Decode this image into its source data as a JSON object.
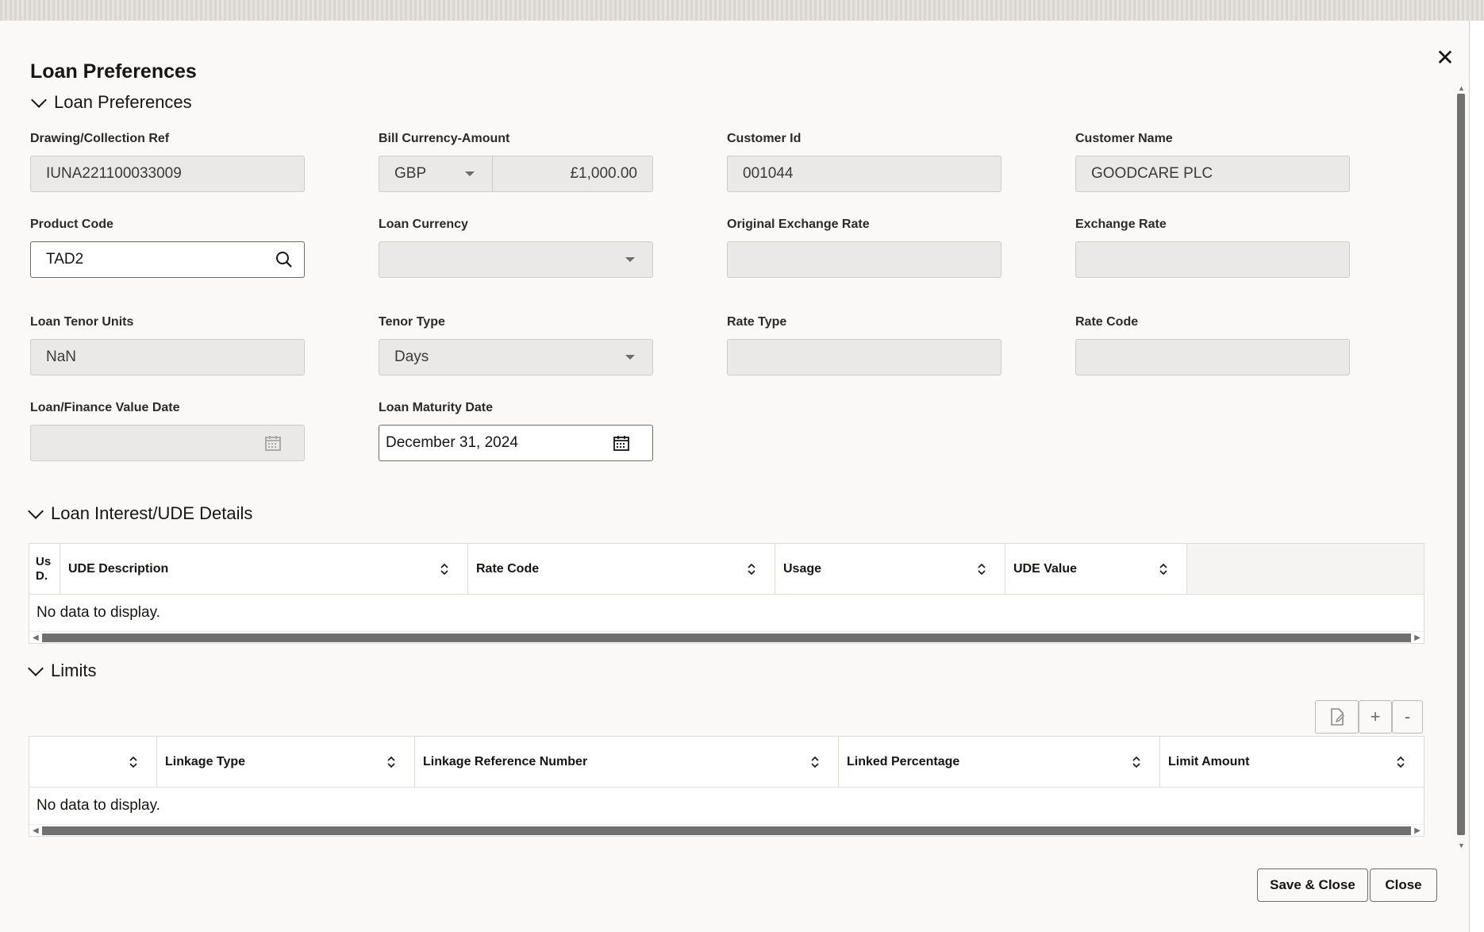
{
  "dialog": {
    "title": "Loan Preferences"
  },
  "sections": {
    "loan_preferences": "Loan Preferences",
    "interest": "Loan Interest/UDE Details",
    "limits": "Limits"
  },
  "fields": {
    "drawing_ref": {
      "label": "Drawing/Collection Ref",
      "value": "IUNA221100033009"
    },
    "bill_currency": {
      "label": "Bill Currency-Amount",
      "currency": "GBP",
      "amount": "£1,000.00"
    },
    "customer_id": {
      "label": "Customer Id",
      "value": "001044"
    },
    "customer_name": {
      "label": "Customer Name",
      "value": "GOODCARE PLC"
    },
    "product_code": {
      "label": "Product Code",
      "value": "TAD2"
    },
    "loan_currency": {
      "label": "Loan Currency",
      "value": ""
    },
    "original_exchange_rate": {
      "label": "Original Exchange Rate",
      "value": ""
    },
    "exchange_rate": {
      "label": "Exchange Rate",
      "value": ""
    },
    "loan_tenor_units": {
      "label": "Loan Tenor Units",
      "value": "NaN"
    },
    "tenor_type": {
      "label": "Tenor Type",
      "value": "Days"
    },
    "rate_type": {
      "label": "Rate Type",
      "value": ""
    },
    "rate_code": {
      "label": "Rate Code",
      "value": ""
    },
    "value_date": {
      "label": "Loan/Finance Value Date",
      "value": ""
    },
    "maturity_date": {
      "label": "Loan Maturity Date",
      "value": "December 31, 2024"
    }
  },
  "ude_table": {
    "columns": [
      "Us\nD.",
      "UDE Description",
      "Rate Code",
      "Usage",
      "UDE Value"
    ],
    "empty_text": "No data to display."
  },
  "limits_table": {
    "columns": [
      "",
      "Linkage Type",
      "Linkage Reference Number",
      "Linked Percentage",
      "Limit Amount"
    ],
    "empty_text": "No data to display.",
    "toolbar": {
      "add": "+",
      "remove": "-"
    }
  },
  "footer": {
    "save_close": "Save & Close",
    "close": "Close"
  },
  "icons": {
    "close": "close-icon",
    "search": "search-icon",
    "calendar": "calendar-icon",
    "sort": "sort-icon",
    "edit": "edit-document-icon"
  }
}
